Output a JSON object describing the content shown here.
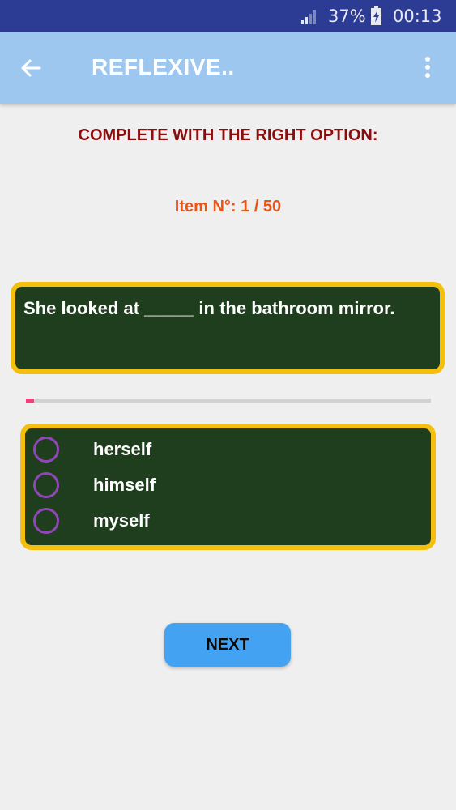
{
  "status_bar": {
    "battery_percent": "37%",
    "time": "00:13",
    "icons": [
      "signal-icon",
      "battery-charging-icon"
    ]
  },
  "app_bar": {
    "title": "REFLEXIVE..",
    "icons": [
      "back-arrow-icon",
      "overflow-menu-icon"
    ]
  },
  "quiz": {
    "instruction": "COMPLETE WITH THE RIGHT OPTION:",
    "item_counter": "Item N°: 1 / 50",
    "question": "She looked at _____ in the bathroom mirror.",
    "progress_fraction": 0.02,
    "options": [
      {
        "label": "herself",
        "selected": false
      },
      {
        "label": "himself",
        "selected": false
      },
      {
        "label": "myself",
        "selected": false
      }
    ],
    "next_label": "NEXT"
  },
  "colors": {
    "status_bar": "#2c3b93",
    "app_bar": "#9ec7f0",
    "card_background": "#1f3e1e",
    "card_border": "#f5bf0d",
    "instruction": "#8b0e0e",
    "counter": "#ee5314",
    "progress_fill": "#ee407a",
    "radio": "#9146b8",
    "next_button": "#43a2f2"
  }
}
